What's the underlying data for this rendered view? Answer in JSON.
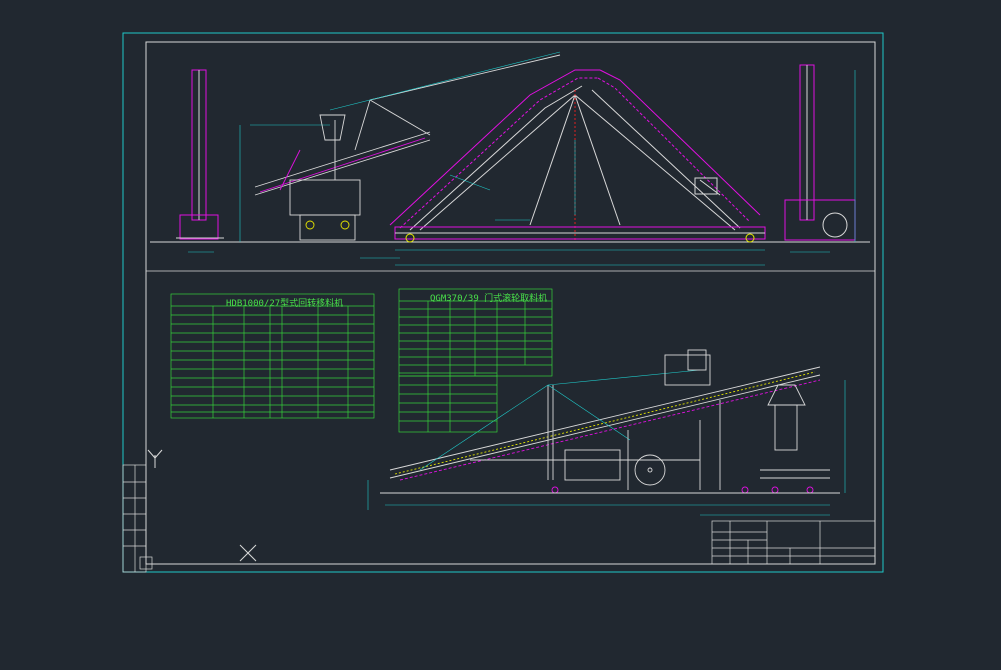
{
  "drawing": {
    "background_color": "#212830",
    "frame_color": "#1fc8c8",
    "inner_frame_color": "#e6e6e6",
    "conveyor_color": "#e010e0",
    "structure_color": "#e6e6e6",
    "dimension_color": "#1fc8c8",
    "table_color": "#36d13a"
  },
  "table_left": {
    "title": "HDB1000/27型式回转移料机"
  },
  "table_right": {
    "title": "QGM370/39 门式滚轮取料机"
  },
  "markers": {
    "ucs_icon": "Y",
    "cross_marker": "X"
  }
}
